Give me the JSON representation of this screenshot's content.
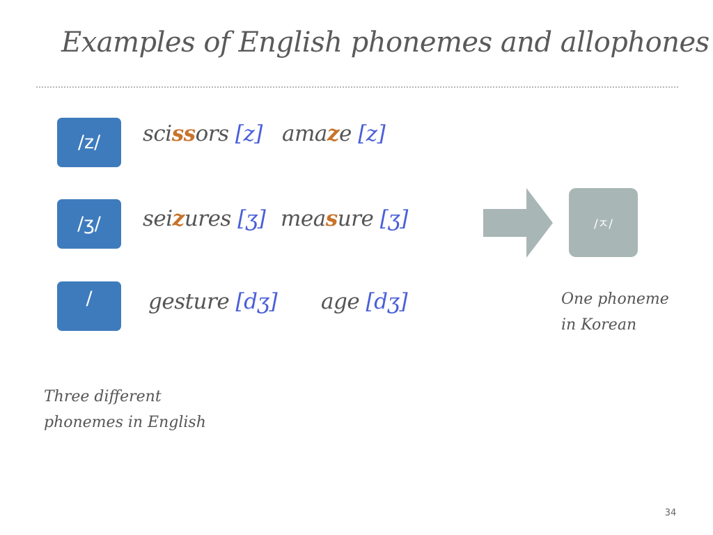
{
  "title": "Examples of English phonemes and allophones",
  "phoneme_boxes": [
    {
      "label": "/z/",
      "color": "#3e7bbd"
    },
    {
      "label": "/ʒ/",
      "color": "#3e7bbd"
    },
    {
      "label": "/",
      "color": "#3e7bbd"
    }
  ],
  "rows": [
    {
      "examples": [
        {
          "parts": [
            "sci",
            "ss",
            "ors"
          ],
          "ipa": "[z]"
        },
        {
          "parts": [
            "ama",
            "z",
            "e"
          ],
          "ipa": "[z]"
        }
      ]
    },
    {
      "examples": [
        {
          "parts": [
            "sei",
            "z",
            "ures"
          ],
          "ipa": "[ʒ]"
        },
        {
          "parts": [
            "mea",
            "s",
            "ure"
          ],
          "ipa": "[ʒ]"
        }
      ]
    },
    {
      "examples": [
        {
          "parts": [
            "gesture"
          ],
          "ipa": "[dʒ]"
        },
        {
          "parts": [
            "age"
          ],
          "ipa": "[dʒ]"
        }
      ]
    }
  ],
  "korean_box": {
    "label": "/ㅈ/",
    "color": "#a9b6b6"
  },
  "arrow_color": "#a9b6b6",
  "highlight_color": "#c8732a",
  "ipa_color": "#4a5fd8",
  "korean_caption": {
    "line1": "One phoneme",
    "line2": "in Korean"
  },
  "english_caption": {
    "line1": "Three different",
    "line2": "phonemes in English"
  },
  "page_number": "34"
}
